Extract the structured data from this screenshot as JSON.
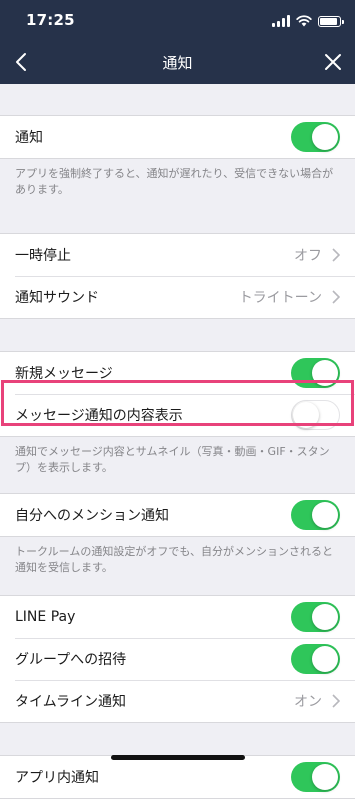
{
  "status_bar": {
    "time": "17:25"
  },
  "nav": {
    "title": "通知"
  },
  "sections": {
    "notify": {
      "label": "通知",
      "toggle": "on",
      "footnote": "アプリを強制終了すると、通知が遅れたり、受信できない場合があります。"
    },
    "pause": {
      "label": "一時停止",
      "value": "オフ"
    },
    "sound": {
      "label": "通知サウンド",
      "value": "トライトーン"
    },
    "new_message": {
      "label": "新規メッセージ",
      "toggle": "on"
    },
    "message_content": {
      "label": "メッセージ通知の内容表示",
      "toggle": "off",
      "footnote": "通知でメッセージ内容とサムネイル（写真・動画・GIF・スタンプ）を表示します。"
    },
    "mention": {
      "label": "自分へのメンション通知",
      "toggle": "on",
      "footnote": "トークルームの通知設定がオフでも、自分がメンションされると通知を受信します。"
    },
    "line_pay": {
      "label": "LINE Pay",
      "toggle": "on"
    },
    "group_invite": {
      "label": "グループへの招待",
      "toggle": "on"
    },
    "timeline": {
      "label": "タイムライン通知",
      "value": "オン"
    },
    "in_app": {
      "label": "アプリ内通知",
      "toggle": "on"
    }
  },
  "colors": {
    "header": "#26324a",
    "toggle_on": "#2fc65a",
    "highlight": "#e8427a",
    "background": "#efeff4"
  }
}
